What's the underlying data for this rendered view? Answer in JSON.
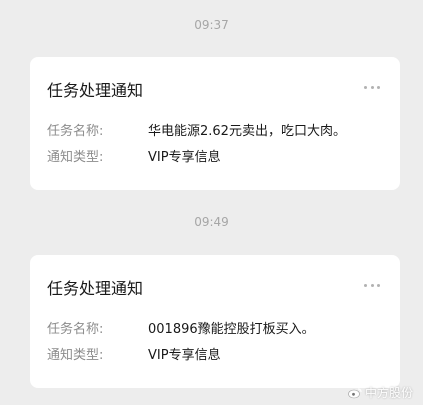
{
  "messages": [
    {
      "time": "09:37",
      "title": "任务处理通知",
      "rows": [
        {
          "label": "任务名称:",
          "value": "华电能源2.62元卖出，吃口大肉。"
        },
        {
          "label": "通知类型:",
          "value": "VIP专享信息"
        }
      ]
    },
    {
      "time": "09:49",
      "title": "任务处理通知",
      "rows": [
        {
          "label": "任务名称:",
          "value": "001896豫能控股打板买入。"
        },
        {
          "label": "通知类型:",
          "value": "VIP专享信息"
        }
      ]
    }
  ],
  "watermark": {
    "text": "中方股份",
    "icon": "weibo-icon"
  },
  "colors": {
    "background": "#ededed",
    "card": "#ffffff",
    "label": "#8c8c8c",
    "text": "#191919",
    "time": "#a6a6a6"
  }
}
